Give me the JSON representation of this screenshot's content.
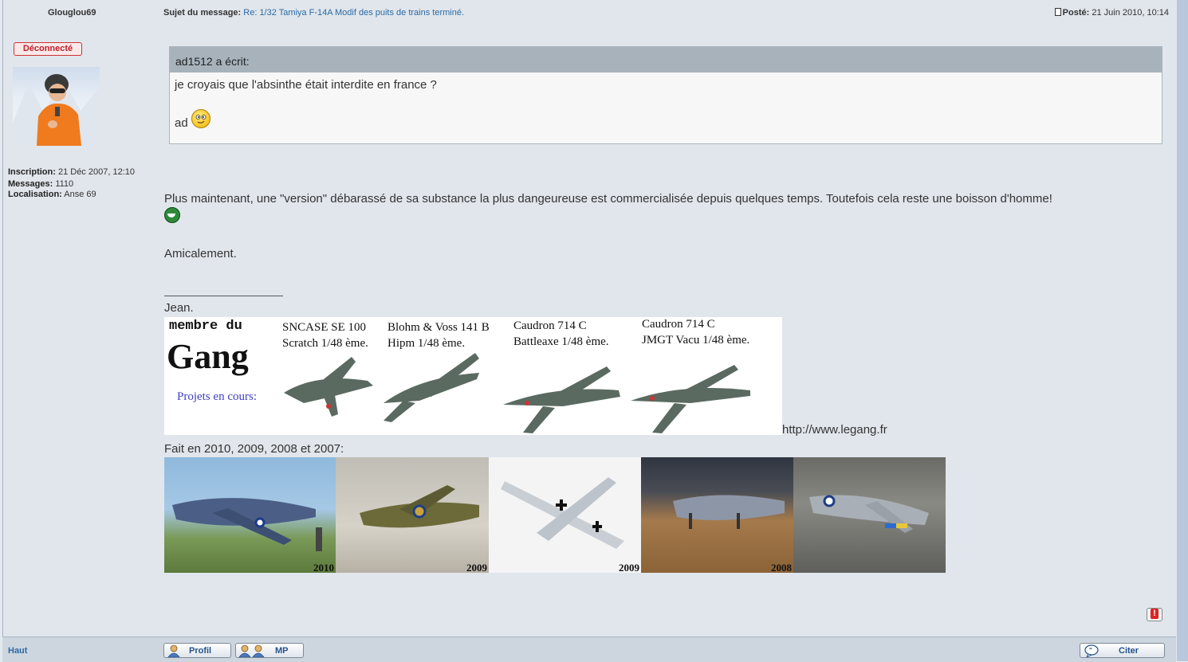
{
  "post": {
    "author": "Glouglou69",
    "subject_label": "Sujet du message:",
    "subject_link": "Re: 1/32 Tamiya F-14A Modif des puits de trains terminé.",
    "posted_label": "Posté:",
    "posted_date": "21 Juin 2010, 10:14",
    "status_badge": "Déconnecté"
  },
  "profile": {
    "inscription_label": "Inscription:",
    "inscription_value": "21 Déc 2007, 12:10",
    "messages_label": "Messages:",
    "messages_value": "1110",
    "localisation_label": "Localisation:",
    "localisation_value": "Anse 69"
  },
  "quote": {
    "header": "ad1512 a écrit:",
    "line1": "je croyais que l'absinthe était interdite en france ?",
    "line2": "ad"
  },
  "body": {
    "paragraph": "Plus maintenant, une \"version\" débarassé de sa substance la plus dangeureuse est commercialisée depuis quelques temps. Toutefois cela reste une boisson d'homme!",
    "greeting": "Amicalement.",
    "signature_name": "Jean.",
    "site_url": "http://www.legang.fr",
    "made_in": "Fait en 2010, 2009, 2008 et 2007:"
  },
  "banner": {
    "membre": "membre du",
    "gang": "Gang",
    "projets": "Projets en cours:",
    "p1_line1": "SNCASE SE 100",
    "p1_line2": "Scratch 1/48 ème.",
    "p2_line1": "Blohm & Voss 141 B",
    "p2_line2": "Hipm 1/48 ème.",
    "p3_line1": "Caudron 714 C",
    "p3_line2": "Battleaxe 1/48 ème.",
    "p4_line1": "Caudron 714 C",
    "p4_line2": "JMGT Vacu 1/48 ème."
  },
  "photos": {
    "y1": "2010",
    "y2": "2009",
    "y3": "2009",
    "y4": "2008"
  },
  "footer": {
    "haut": "Haut",
    "profil": "Profil",
    "mp": "MP",
    "citer": "Citer"
  }
}
